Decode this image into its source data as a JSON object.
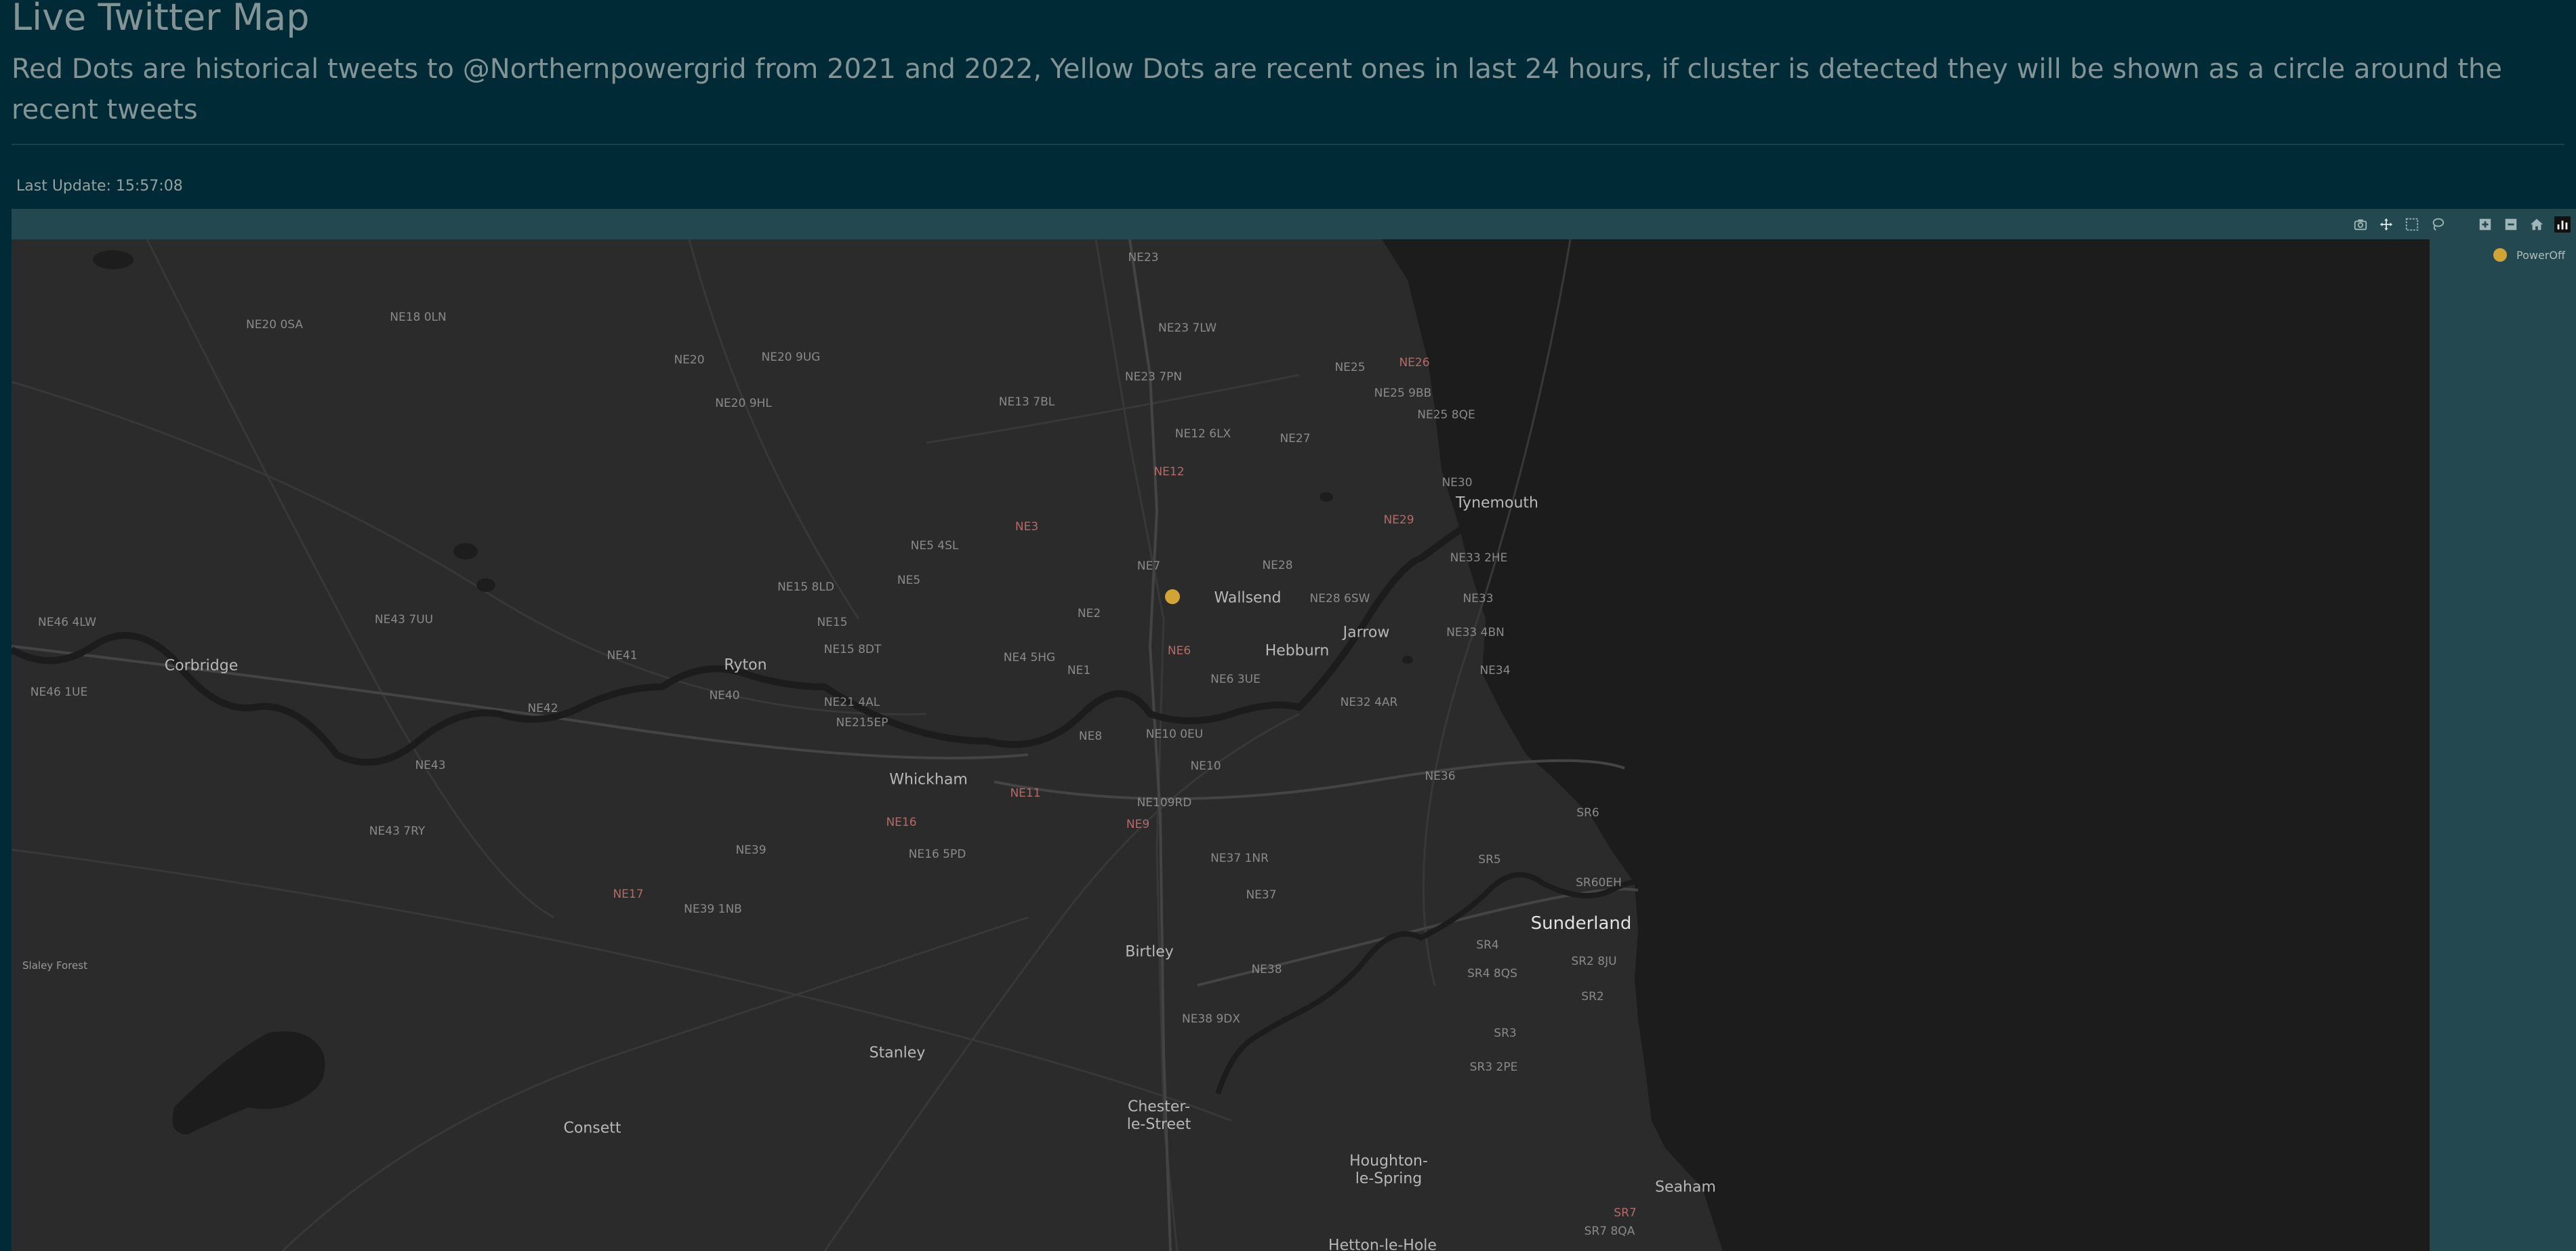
{
  "header": {
    "title": "Live Twitter Map",
    "subtitle": "Red Dots are historical tweets to @Northernpowergrid from 2021 and 2022, Yellow Dots are recent ones in last 24 hours, if cluster is detected they will be shown as a circle around the recent tweets"
  },
  "status": {
    "last_update": "Last Update: 15:57:08"
  },
  "modebar": {
    "icons": [
      "camera-icon",
      "pan-icon",
      "box-select-icon",
      "lasso-select-icon",
      "zoom-in-icon",
      "zoom-out-icon",
      "home-icon",
      "plotly-logo-icon"
    ],
    "glyph_zoom_in": "+",
    "glyph_zoom_out": "−",
    "glyph_home": "⌂"
  },
  "legend": {
    "items": [
      {
        "label": "PowerOff",
        "color": "#d2a436"
      }
    ]
  },
  "colors": {
    "page_background": "#002b36",
    "plot_background": "#244850",
    "map_land": "#2b2b2b",
    "map_sea": "#1b1c1b",
    "recent_tweet": "#d2a436",
    "postcode_highlight": "#b46a6a"
  },
  "map": {
    "places": {
      "ne23": "NE23",
      "ne20_0sa": "NE20 0SA",
      "ne18_0ln": "NE18 0LN",
      "ne23_7lw": "NE23 7LW",
      "ne20": "NE20",
      "ne20_9ug": "NE20 9UG",
      "ne25": "NE25",
      "ne26": "NE26",
      "ne23_7pn": "NE23 7PN",
      "ne25_9bb": "NE25 9BB",
      "ne20_9hl": "NE20 9HL",
      "ne13_7bl": "NE13 7BL",
      "ne25_8qe": "NE25 8QE",
      "ne12_6lx": "NE12 6LX",
      "ne27": "NE27",
      "ne12": "NE12",
      "ne30": "NE30",
      "tynemouth": "Tynemouth",
      "ne29": "NE29",
      "ne3": "NE3",
      "ne5_4sl": "NE5 4SL",
      "ne33_2he": "NE33 2HE",
      "ne7": "NE7",
      "ne28": "NE28",
      "ne5": "NE5",
      "ne15_8ld": "NE15 8LD",
      "wallsend": "Wallsend",
      "ne28_6sw": "NE28 6SW",
      "ne33": "NE33",
      "ne2": "NE2",
      "ne46_4lw": "NE46 4LW",
      "ne43_7uu": "NE43 7UU",
      "ne15": "NE15",
      "jarrow": "Jarrow",
      "ne33_4bn": "NE33 4BN",
      "hebburn": "Hebburn",
      "ne15_8dt": "NE15 8DT",
      "ne6": "NE6",
      "ne41": "NE41",
      "ryton": "Ryton",
      "ne4_5hg": "NE4 5HG",
      "corbridge": "Corbridge",
      "ne1": "NE1",
      "ne34": "NE34",
      "ne6_3ue": "NE6 3UE",
      "ne46_1ue": "NE46 1UE",
      "ne40": "NE40",
      "ne21_4al": "NE21 4AL",
      "ne32_4ar": "NE32 4AR",
      "ne42": "NE42",
      "ne21_5ep": "NE215EP",
      "ne10_0eu": "NE10 0EU",
      "ne8": "NE8",
      "ne43": "NE43",
      "ne10": "NE10",
      "ne36": "NE36",
      "whickham": "Whickham",
      "ne11": "NE11",
      "ne10_9rd": "NE109RD",
      "ne16": "NE16",
      "sr6": "SR6",
      "ne9": "NE9",
      "ne43_7ry": "NE43 7RY",
      "ne39": "NE39",
      "ne16_5pd": "NE16 5PD",
      "sr5": "SR5",
      "ne37_1nr": "NE37 1NR",
      "sr6_0eh": "SR60EH",
      "ne17": "NE17",
      "ne37": "NE37",
      "ne39_1nb": "NE39 1NB",
      "sunderland": "Sunderland",
      "slaley_forest": "Slaley Forest",
      "sr4": "SR4",
      "birtley": "Birtley",
      "sr2_8ju": "SR2 8JU",
      "ne38": "NE38",
      "sr4_8qs": "SR4 8QS",
      "sr2": "SR2",
      "ne38_9dx": "NE38 9DX",
      "stanley": "Stanley",
      "sr3": "SR3",
      "sr3_2pe": "SR3 2PE",
      "chester_1": "Chester-",
      "chester_2": "le-Street",
      "consett": "Consett",
      "houghton_1": "Houghton-",
      "houghton_2": "le-Spring",
      "seaham": "Seaham",
      "sr7": "SR7",
      "sr7_8qa": "SR7 8QA",
      "hetton": "Hetton-le-Hole"
    }
  }
}
